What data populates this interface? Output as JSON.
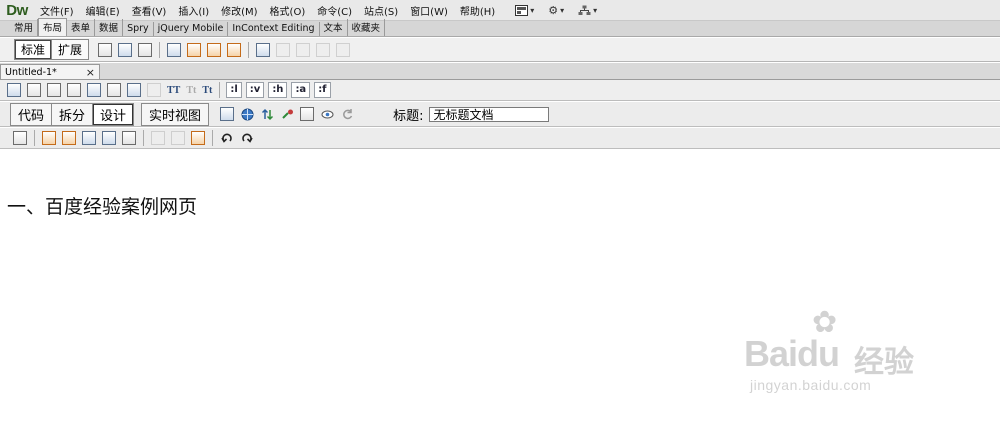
{
  "app": {
    "logo": "Dw"
  },
  "menu": [
    "文件(F)",
    "编辑(E)",
    "查看(V)",
    "插入(I)",
    "修改(M)",
    "格式(O)",
    "命令(C)",
    "站点(S)",
    "窗口(W)",
    "帮助(H)"
  ],
  "menu_icons": [
    "layout-icon",
    "gear-icon",
    "site-icon"
  ],
  "insert_tabs": [
    "常用",
    "布局",
    "表单",
    "数据",
    "Spry",
    "jQuery Mobile",
    "InContext Editing",
    "文本",
    "收藏夹"
  ],
  "insert_active_tab": "布局",
  "layout_modes": {
    "standard": "标准",
    "expanded": "扩展"
  },
  "document_tab": {
    "name": "Untitled-1*",
    "close": "×"
  },
  "style_bar": {
    "pseudo_classes": [
      ":l",
      ":v",
      ":h",
      ":a",
      ":f"
    ]
  },
  "views": {
    "code": "代码",
    "split": "拆分",
    "design": "设计",
    "live": "实时视图"
  },
  "title": {
    "label": "标题:",
    "value": "无标题文档"
  },
  "content": {
    "heading": "一、百度经验案例网页"
  },
  "watermark": {
    "brand": "Bai",
    "brand2": "du",
    "cn": "经验",
    "url": "jingyan.baidu.com"
  },
  "colors": {
    "logo": "#2e5d1f",
    "accent_orange": "#c46b1a"
  }
}
